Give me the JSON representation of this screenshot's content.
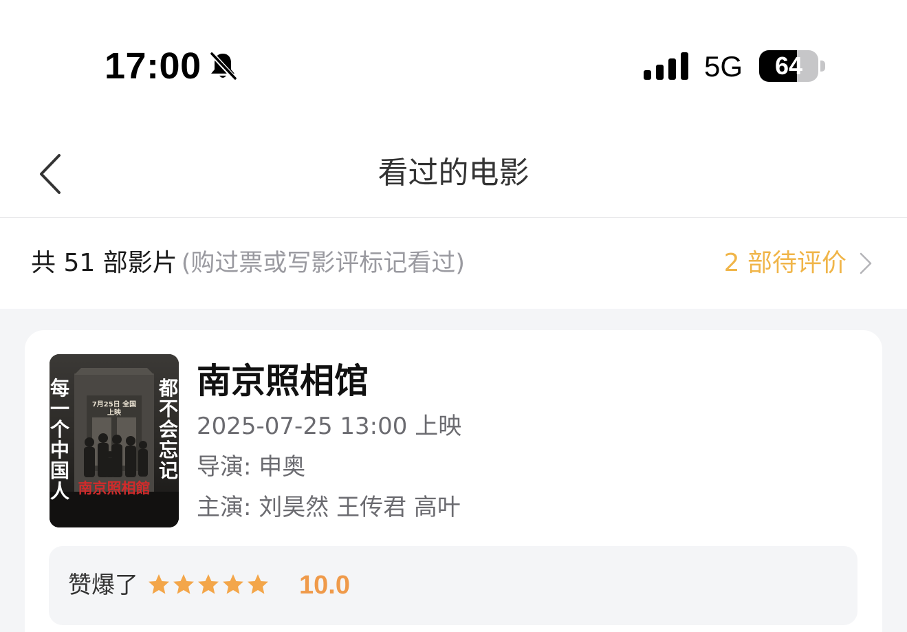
{
  "status_bar": {
    "time": "17:00",
    "network": "5G",
    "battery_level": "64",
    "battery_fraction": 0.64
  },
  "nav": {
    "title": "看过的电影",
    "back_icon": "chevron-left-icon"
  },
  "summary": {
    "count_text": "共 51 部影片",
    "note_text": "(购过票或写影评标记看过)",
    "pending_text": "2 部待评价",
    "accent_color": "#f0b549"
  },
  "movies": [
    {
      "title": "南京照相馆",
      "release": "2025-07-25 13:00 上映",
      "director": "导演: 申奥",
      "cast": "主演: 刘昊然 王传君 高叶",
      "poster": {
        "left_text": "每一个中国人",
        "right_text": "都不会忘记",
        "date_text": "7月25日 全国上映",
        "title_text": "南京照相館"
      },
      "rating": {
        "label": "赞爆了",
        "stars": 5,
        "score": "10.0",
        "star_color": "#f3a64a",
        "score_color": "#ef9a4a"
      }
    }
  ]
}
